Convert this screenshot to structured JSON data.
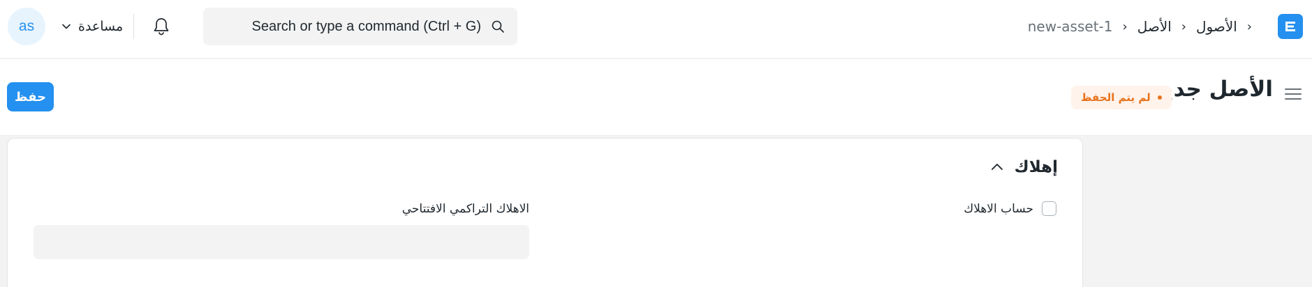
{
  "navbar": {
    "logo_letter": "E",
    "breadcrumbs": [
      "الأصول",
      "الأصل",
      "new-asset-1"
    ],
    "search_placeholder": "Search or type a command (Ctrl + G)",
    "help_label": "مساعدة",
    "avatar_initials": "as",
    "accent_color": "#2490ef"
  },
  "page": {
    "title": "الأصل جديد",
    "status": "لم يتم الحفظ",
    "save_label": "حفظ"
  },
  "section": {
    "title": "إهلاك",
    "checkbox_label": "حساب الاهلاك",
    "checkbox_checked": false,
    "field_label": "الاهلاك التراكمي الافتتاحي",
    "field_value": ""
  }
}
